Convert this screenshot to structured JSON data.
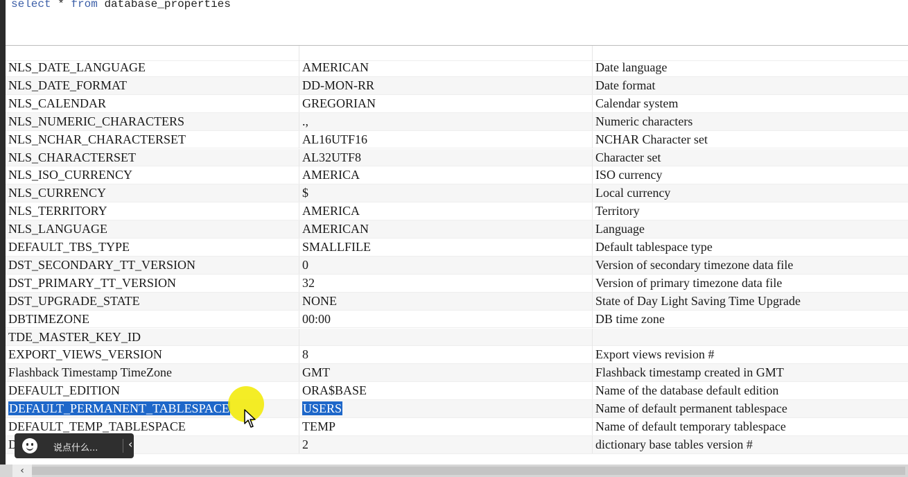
{
  "editor": {
    "sql_keyword_1": "select",
    "sql_star": "*",
    "sql_keyword_2": "from",
    "sql_table": "database_properties"
  },
  "rows": [
    {
      "name": "NLS_DATE_LANGUAGE",
      "value": "AMERICAN",
      "description": "Date language"
    },
    {
      "name": "NLS_DATE_FORMAT",
      "value": "DD-MON-RR",
      "description": "Date format"
    },
    {
      "name": "NLS_CALENDAR",
      "value": "GREGORIAN",
      "description": "Calendar system"
    },
    {
      "name": "NLS_NUMERIC_CHARACTERS",
      "value": ".,",
      "description": "Numeric characters"
    },
    {
      "name": "NLS_NCHAR_CHARACTERSET",
      "value": "AL16UTF16",
      "description": "NCHAR Character set"
    },
    {
      "name": "NLS_CHARACTERSET",
      "value": "AL32UTF8",
      "description": "Character set"
    },
    {
      "name": "NLS_ISO_CURRENCY",
      "value": "AMERICA",
      "description": "ISO currency"
    },
    {
      "name": "NLS_CURRENCY",
      "value": "$",
      "description": "Local currency"
    },
    {
      "name": "NLS_TERRITORY",
      "value": "AMERICA",
      "description": "Territory"
    },
    {
      "name": "NLS_LANGUAGE",
      "value": "AMERICAN",
      "description": "Language"
    },
    {
      "name": "DEFAULT_TBS_TYPE",
      "value": "SMALLFILE",
      "description": "Default tablespace type"
    },
    {
      "name": "DST_SECONDARY_TT_VERSION",
      "value": "0",
      "description": "Version of secondary timezone data file"
    },
    {
      "name": "DST_PRIMARY_TT_VERSION",
      "value": "32",
      "description": "Version of primary timezone data file"
    },
    {
      "name": "DST_UPGRADE_STATE",
      "value": "NONE",
      "description": "State of Day Light Saving Time Upgrade"
    },
    {
      "name": "DBTIMEZONE",
      "value": "00:00",
      "description": "DB time zone"
    },
    {
      "name": "TDE_MASTER_KEY_ID",
      "value": "",
      "description": ""
    },
    {
      "name": "EXPORT_VIEWS_VERSION",
      "value": "8",
      "description": "Export views revision #"
    },
    {
      "name": "Flashback Timestamp TimeZone",
      "value": "GMT",
      "description": "Flashback timestamp created in GMT"
    },
    {
      "name": "DEFAULT_EDITION",
      "value": "ORA$BASE",
      "description": "Name of the database default edition"
    },
    {
      "name": "DEFAULT_PERMANENT_TABLESPACE",
      "value": "USERS",
      "description": "Name of default permanent tablespace",
      "selected": true
    },
    {
      "name": "DEFAULT_TEMP_TABLESPACE",
      "value": "TEMP",
      "description": "Name of default temporary tablespace"
    },
    {
      "name": "D   B",
      "value": "2",
      "description": "dictionary base tables version #"
    }
  ],
  "danmaku": {
    "placeholder": "说点什么...",
    "back_icon": "‹"
  },
  "scrollbar": {
    "left_arrow": "‹"
  },
  "colors": {
    "selection": "#1e67c9",
    "cursor_highlight": "#f2ea00",
    "sql_keyword": "#3c5fa8"
  }
}
